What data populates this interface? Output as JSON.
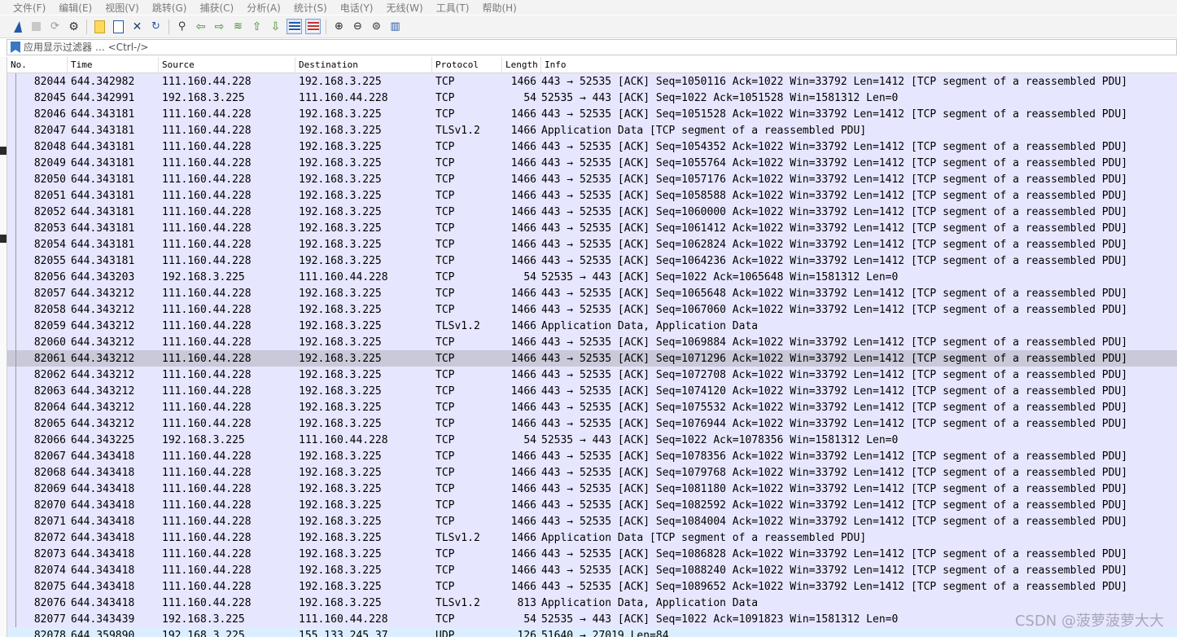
{
  "menu": [
    "文件(F)",
    "编辑(E)",
    "视图(V)",
    "跳转(G)",
    "捕获(C)",
    "分析(A)",
    "统计(S)",
    "电话(Y)",
    "无线(W)",
    "工具(T)",
    "帮助(H)"
  ],
  "toolbar_icons": [
    "shark-fin-start-icon",
    "stop-square-icon",
    "restart-icon",
    "options-gear-icon",
    "open-file-icon",
    "save-file-icon",
    "close-file-icon",
    "reload-icon",
    "find-packet-icon",
    "go-back-icon",
    "go-forward-icon",
    "go-to-packet-icon",
    "first-packet-icon",
    "last-packet-icon",
    "autoscroll-icon",
    "colorize-icon",
    "zoom-in-icon",
    "zoom-out-icon",
    "zoom-normal-icon",
    "resize-columns-icon"
  ],
  "filter": {
    "placeholder": "应用显示过滤器 … <Ctrl-/>"
  },
  "columns": [
    "No.",
    "Time",
    "Source",
    "Destination",
    "Protocol",
    "Length",
    "Info"
  ],
  "rows": [
    {
      "no": "82044",
      "time": "644.342982",
      "src": "111.160.44.228",
      "dst": "192.168.3.225",
      "proto": "TCP",
      "len": "1466",
      "info": "443 → 52535 [ACK] Seq=1050116 Ack=1022 Win=33792 Len=1412 [TCP segment of a reassembled PDU]"
    },
    {
      "no": "82045",
      "time": "644.342991",
      "src": "192.168.3.225",
      "dst": "111.160.44.228",
      "proto": "TCP",
      "len": "54",
      "info": "52535 → 443 [ACK] Seq=1022 Ack=1051528 Win=1581312 Len=0"
    },
    {
      "no": "82046",
      "time": "644.343181",
      "src": "111.160.44.228",
      "dst": "192.168.3.225",
      "proto": "TCP",
      "len": "1466",
      "info": "443 → 52535 [ACK] Seq=1051528 Ack=1022 Win=33792 Len=1412 [TCP segment of a reassembled PDU]"
    },
    {
      "no": "82047",
      "time": "644.343181",
      "src": "111.160.44.228",
      "dst": "192.168.3.225",
      "proto": "TLSv1.2",
      "len": "1466",
      "info": "Application Data [TCP segment of a reassembled PDU]"
    },
    {
      "no": "82048",
      "time": "644.343181",
      "src": "111.160.44.228",
      "dst": "192.168.3.225",
      "proto": "TCP",
      "len": "1466",
      "info": "443 → 52535 [ACK] Seq=1054352 Ack=1022 Win=33792 Len=1412 [TCP segment of a reassembled PDU]"
    },
    {
      "no": "82049",
      "time": "644.343181",
      "src": "111.160.44.228",
      "dst": "192.168.3.225",
      "proto": "TCP",
      "len": "1466",
      "info": "443 → 52535 [ACK] Seq=1055764 Ack=1022 Win=33792 Len=1412 [TCP segment of a reassembled PDU]"
    },
    {
      "no": "82050",
      "time": "644.343181",
      "src": "111.160.44.228",
      "dst": "192.168.3.225",
      "proto": "TCP",
      "len": "1466",
      "info": "443 → 52535 [ACK] Seq=1057176 Ack=1022 Win=33792 Len=1412 [TCP segment of a reassembled PDU]"
    },
    {
      "no": "82051",
      "time": "644.343181",
      "src": "111.160.44.228",
      "dst": "192.168.3.225",
      "proto": "TCP",
      "len": "1466",
      "info": "443 → 52535 [ACK] Seq=1058588 Ack=1022 Win=33792 Len=1412 [TCP segment of a reassembled PDU]"
    },
    {
      "no": "82052",
      "time": "644.343181",
      "src": "111.160.44.228",
      "dst": "192.168.3.225",
      "proto": "TCP",
      "len": "1466",
      "info": "443 → 52535 [ACK] Seq=1060000 Ack=1022 Win=33792 Len=1412 [TCP segment of a reassembled PDU]"
    },
    {
      "no": "82053",
      "time": "644.343181",
      "src": "111.160.44.228",
      "dst": "192.168.3.225",
      "proto": "TCP",
      "len": "1466",
      "info": "443 → 52535 [ACK] Seq=1061412 Ack=1022 Win=33792 Len=1412 [TCP segment of a reassembled PDU]"
    },
    {
      "no": "82054",
      "time": "644.343181",
      "src": "111.160.44.228",
      "dst": "192.168.3.225",
      "proto": "TCP",
      "len": "1466",
      "info": "443 → 52535 [ACK] Seq=1062824 Ack=1022 Win=33792 Len=1412 [TCP segment of a reassembled PDU]"
    },
    {
      "no": "82055",
      "time": "644.343181",
      "src": "111.160.44.228",
      "dst": "192.168.3.225",
      "proto": "TCP",
      "len": "1466",
      "info": "443 → 52535 [ACK] Seq=1064236 Ack=1022 Win=33792 Len=1412 [TCP segment of a reassembled PDU]"
    },
    {
      "no": "82056",
      "time": "644.343203",
      "src": "192.168.3.225",
      "dst": "111.160.44.228",
      "proto": "TCP",
      "len": "54",
      "info": "52535 → 443 [ACK] Seq=1022 Ack=1065648 Win=1581312 Len=0"
    },
    {
      "no": "82057",
      "time": "644.343212",
      "src": "111.160.44.228",
      "dst": "192.168.3.225",
      "proto": "TCP",
      "len": "1466",
      "info": "443 → 52535 [ACK] Seq=1065648 Ack=1022 Win=33792 Len=1412 [TCP segment of a reassembled PDU]"
    },
    {
      "no": "82058",
      "time": "644.343212",
      "src": "111.160.44.228",
      "dst": "192.168.3.225",
      "proto": "TCP",
      "len": "1466",
      "info": "443 → 52535 [ACK] Seq=1067060 Ack=1022 Win=33792 Len=1412 [TCP segment of a reassembled PDU]"
    },
    {
      "no": "82059",
      "time": "644.343212",
      "src": "111.160.44.228",
      "dst": "192.168.3.225",
      "proto": "TLSv1.2",
      "len": "1466",
      "info": "Application Data, Application Data"
    },
    {
      "no": "82060",
      "time": "644.343212",
      "src": "111.160.44.228",
      "dst": "192.168.3.225",
      "proto": "TCP",
      "len": "1466",
      "info": "443 → 52535 [ACK] Seq=1069884 Ack=1022 Win=33792 Len=1412 [TCP segment of a reassembled PDU]"
    },
    {
      "no": "82061",
      "time": "644.343212",
      "src": "111.160.44.228",
      "dst": "192.168.3.225",
      "proto": "TCP",
      "len": "1466",
      "info": "443 → 52535 [ACK] Seq=1071296 Ack=1022 Win=33792 Len=1412 [TCP segment of a reassembled PDU]",
      "selected": true
    },
    {
      "no": "82062",
      "time": "644.343212",
      "src": "111.160.44.228",
      "dst": "192.168.3.225",
      "proto": "TCP",
      "len": "1466",
      "info": "443 → 52535 [ACK] Seq=1072708 Ack=1022 Win=33792 Len=1412 [TCP segment of a reassembled PDU]"
    },
    {
      "no": "82063",
      "time": "644.343212",
      "src": "111.160.44.228",
      "dst": "192.168.3.225",
      "proto": "TCP",
      "len": "1466",
      "info": "443 → 52535 [ACK] Seq=1074120 Ack=1022 Win=33792 Len=1412 [TCP segment of a reassembled PDU]"
    },
    {
      "no": "82064",
      "time": "644.343212",
      "src": "111.160.44.228",
      "dst": "192.168.3.225",
      "proto": "TCP",
      "len": "1466",
      "info": "443 → 52535 [ACK] Seq=1075532 Ack=1022 Win=33792 Len=1412 [TCP segment of a reassembled PDU]"
    },
    {
      "no": "82065",
      "time": "644.343212",
      "src": "111.160.44.228",
      "dst": "192.168.3.225",
      "proto": "TCP",
      "len": "1466",
      "info": "443 → 52535 [ACK] Seq=1076944 Ack=1022 Win=33792 Len=1412 [TCP segment of a reassembled PDU]"
    },
    {
      "no": "82066",
      "time": "644.343225",
      "src": "192.168.3.225",
      "dst": "111.160.44.228",
      "proto": "TCP",
      "len": "54",
      "info": "52535 → 443 [ACK] Seq=1022 Ack=1078356 Win=1581312 Len=0"
    },
    {
      "no": "82067",
      "time": "644.343418",
      "src": "111.160.44.228",
      "dst": "192.168.3.225",
      "proto": "TCP",
      "len": "1466",
      "info": "443 → 52535 [ACK] Seq=1078356 Ack=1022 Win=33792 Len=1412 [TCP segment of a reassembled PDU]"
    },
    {
      "no": "82068",
      "time": "644.343418",
      "src": "111.160.44.228",
      "dst": "192.168.3.225",
      "proto": "TCP",
      "len": "1466",
      "info": "443 → 52535 [ACK] Seq=1079768 Ack=1022 Win=33792 Len=1412 [TCP segment of a reassembled PDU]"
    },
    {
      "no": "82069",
      "time": "644.343418",
      "src": "111.160.44.228",
      "dst": "192.168.3.225",
      "proto": "TCP",
      "len": "1466",
      "info": "443 → 52535 [ACK] Seq=1081180 Ack=1022 Win=33792 Len=1412 [TCP segment of a reassembled PDU]"
    },
    {
      "no": "82070",
      "time": "644.343418",
      "src": "111.160.44.228",
      "dst": "192.168.3.225",
      "proto": "TCP",
      "len": "1466",
      "info": "443 → 52535 [ACK] Seq=1082592 Ack=1022 Win=33792 Len=1412 [TCP segment of a reassembled PDU]"
    },
    {
      "no": "82071",
      "time": "644.343418",
      "src": "111.160.44.228",
      "dst": "192.168.3.225",
      "proto": "TCP",
      "len": "1466",
      "info": "443 → 52535 [ACK] Seq=1084004 Ack=1022 Win=33792 Len=1412 [TCP segment of a reassembled PDU]"
    },
    {
      "no": "82072",
      "time": "644.343418",
      "src": "111.160.44.228",
      "dst": "192.168.3.225",
      "proto": "TLSv1.2",
      "len": "1466",
      "info": "Application Data [TCP segment of a reassembled PDU]"
    },
    {
      "no": "82073",
      "time": "644.343418",
      "src": "111.160.44.228",
      "dst": "192.168.3.225",
      "proto": "TCP",
      "len": "1466",
      "info": "443 → 52535 [ACK] Seq=1086828 Ack=1022 Win=33792 Len=1412 [TCP segment of a reassembled PDU]"
    },
    {
      "no": "82074",
      "time": "644.343418",
      "src": "111.160.44.228",
      "dst": "192.168.3.225",
      "proto": "TCP",
      "len": "1466",
      "info": "443 → 52535 [ACK] Seq=1088240 Ack=1022 Win=33792 Len=1412 [TCP segment of a reassembled PDU]"
    },
    {
      "no": "82075",
      "time": "644.343418",
      "src": "111.160.44.228",
      "dst": "192.168.3.225",
      "proto": "TCP",
      "len": "1466",
      "info": "443 → 52535 [ACK] Seq=1089652 Ack=1022 Win=33792 Len=1412 [TCP segment of a reassembled PDU]"
    },
    {
      "no": "82076",
      "time": "644.343418",
      "src": "111.160.44.228",
      "dst": "192.168.3.225",
      "proto": "TLSv1.2",
      "len": "813",
      "info": "Application Data, Application Data"
    },
    {
      "no": "82077",
      "time": "644.343439",
      "src": "192.168.3.225",
      "dst": "111.160.44.228",
      "proto": "TCP",
      "len": "54",
      "info": "52535 → 443 [ACK] Seq=1022 Ack=1091823 Win=1581312 Len=0"
    },
    {
      "no": "82078",
      "time": "644.359890",
      "src": "192.168.3.225",
      "dst": "155.133.245.37",
      "proto": "UDP",
      "len": "126",
      "info": "51640 → 27019 Len=84",
      "udp": true
    }
  ],
  "watermark": "CSDN @菠萝菠萝大大",
  "colors": {
    "tcp_row": "#e7e6ff",
    "selected_row": "#c9c9d9",
    "udp_row": "#daeeff"
  }
}
